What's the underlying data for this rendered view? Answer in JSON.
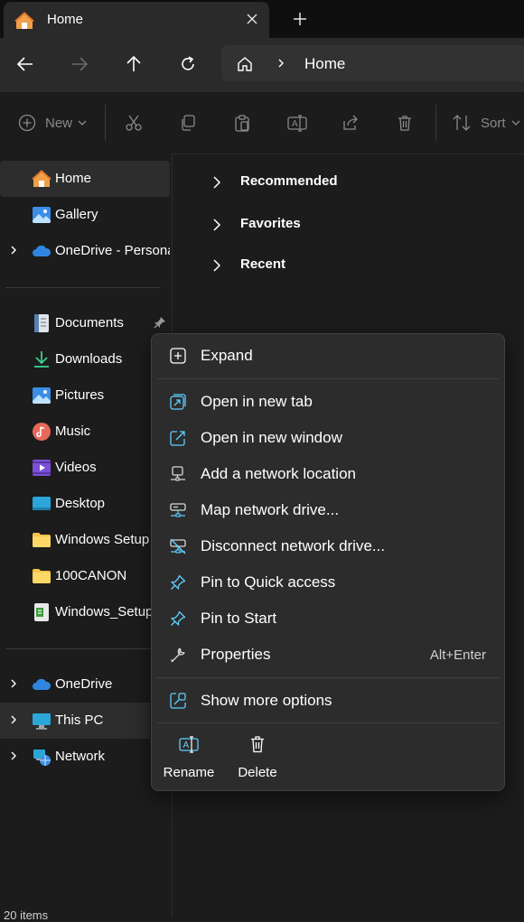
{
  "tab": {
    "title": "Home"
  },
  "address": {
    "path": "Home"
  },
  "commandbar": {
    "new_label": "New",
    "sort_label": "Sort"
  },
  "sidebar": {
    "top": [
      {
        "label": "Home"
      },
      {
        "label": "Gallery"
      },
      {
        "label": "OneDrive - Personal"
      }
    ],
    "quick": [
      {
        "label": "Documents"
      },
      {
        "label": "Downloads"
      },
      {
        "label": "Pictures"
      },
      {
        "label": "Music"
      },
      {
        "label": "Videos"
      },
      {
        "label": "Desktop"
      },
      {
        "label": "Windows Setup"
      },
      {
        "label": "100CANON"
      },
      {
        "label": "Windows_Setup_"
      }
    ],
    "bottom": [
      {
        "label": "OneDrive"
      },
      {
        "label": "This PC"
      },
      {
        "label": "Network"
      }
    ]
  },
  "main": {
    "sections": [
      {
        "label": "Recommended"
      },
      {
        "label": "Favorites"
      },
      {
        "label": "Recent"
      }
    ]
  },
  "context_menu": {
    "expand": "Expand",
    "items": [
      {
        "label": "Open in new tab",
        "icon": "open-new-tab-icon"
      },
      {
        "label": "Open in new window",
        "icon": "open-new-window-icon"
      },
      {
        "label": "Add a network location",
        "icon": "network-location-icon"
      },
      {
        "label": "Map network drive...",
        "icon": "map-drive-icon"
      },
      {
        "label": "Disconnect network drive...",
        "icon": "disconnect-drive-icon"
      },
      {
        "label": "Pin to Quick access",
        "icon": "pin-icon"
      },
      {
        "label": "Pin to Start",
        "icon": "pin-icon"
      },
      {
        "label": "Properties",
        "icon": "wrench-icon",
        "shortcut": "Alt+Enter"
      }
    ],
    "more": "Show more options",
    "rename": "Rename",
    "delete": "Delete"
  },
  "status": {
    "text": "20 items"
  },
  "colors": {
    "accent": "#60cdff",
    "background": "#1c1c1c",
    "menu_bg": "#2c2c2c"
  }
}
